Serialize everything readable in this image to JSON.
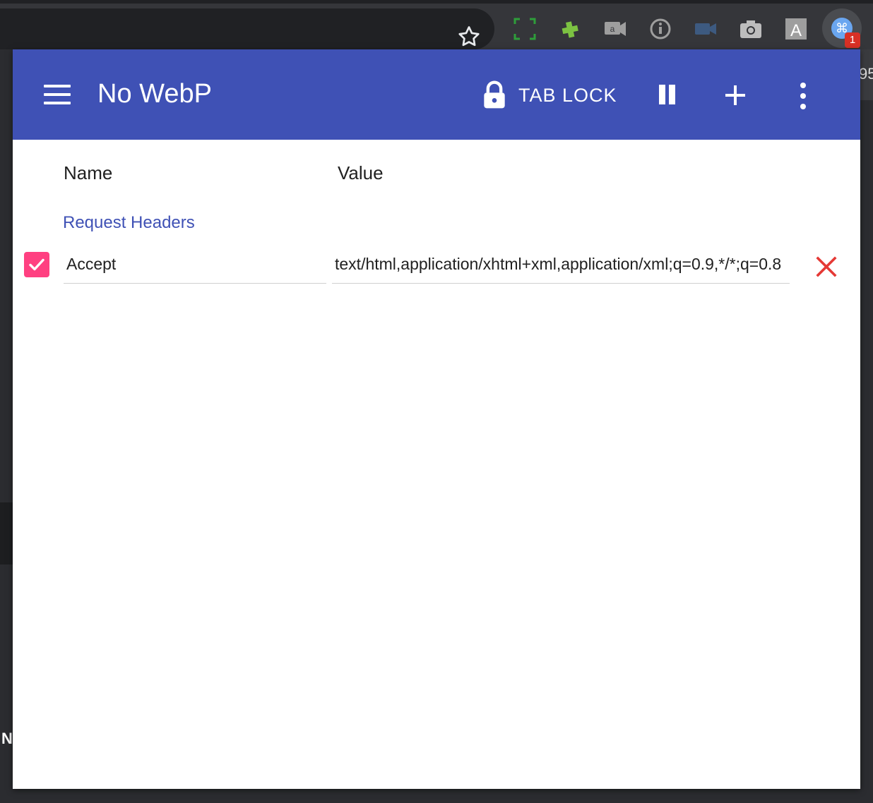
{
  "browser": {
    "badge_count": "1",
    "ext_a_label": "A",
    "edge_text_right": "95",
    "edge_text_left": "N"
  },
  "header": {
    "title": "No WebP",
    "tab_lock_label": "TAB LOCK"
  },
  "table": {
    "name_header": "Name",
    "value_header": "Value"
  },
  "sections": [
    {
      "title": "Request Headers",
      "rows": [
        {
          "enabled": true,
          "name": "Accept",
          "value": "text/html,application/xhtml+xml,application/xml;q=0.9,*/*;q=0.8"
        }
      ]
    }
  ],
  "colors": {
    "appbar": "#3f51b5",
    "checkbox": "#ff4081",
    "delete": "#e53935",
    "section_title": "#3f51b5"
  }
}
